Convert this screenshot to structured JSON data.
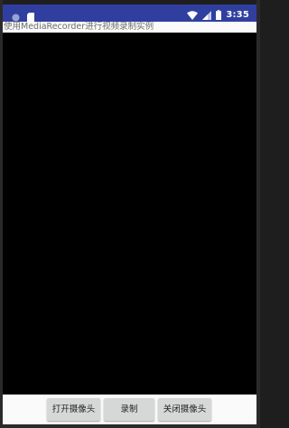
{
  "status_bar": {
    "time": "3:35",
    "left_icons": [
      "circle-notification-icon",
      "sd-card-icon"
    ],
    "right_icons": [
      "wifi-icon",
      "signal-icon",
      "battery-icon"
    ],
    "color": "#303f9f"
  },
  "app": {
    "title": "使用MediaRecorder进行视频录制实例"
  },
  "preview": {
    "color": "#000000"
  },
  "buttons": {
    "open_camera": "打开摄像头",
    "record": "录制",
    "close_camera": "关闭摄像头"
  }
}
